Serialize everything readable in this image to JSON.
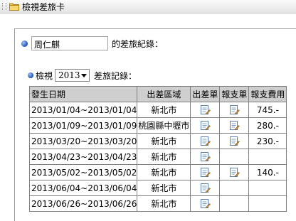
{
  "window": {
    "title": "檢視差旅卡"
  },
  "form": {
    "employee_name": "周仁麒",
    "name_suffix": "的差旅紀錄：",
    "year_label": "檢視",
    "year_value": "2013",
    "year_suffix": "差旅記錄："
  },
  "table": {
    "headers": [
      "發生日期",
      "出差區域",
      "出差單",
      "報支單",
      "報支費用"
    ],
    "rows": [
      {
        "date": "2013/01/04~2013/01/04",
        "area": "新北市",
        "has_trip": true,
        "has_report": true,
        "fee": "745.-"
      },
      {
        "date": "2013/01/09~2013/01/09",
        "area": "桃園縣中壢市",
        "has_trip": true,
        "has_report": true,
        "fee": "280.-"
      },
      {
        "date": "2013/03/20~2013/03/20",
        "area": "新北市",
        "has_trip": true,
        "has_report": true,
        "fee": "230.-"
      },
      {
        "date": "2013/04/23~2013/04/23",
        "area": "新北市",
        "has_trip": true,
        "has_report": false,
        "fee": ""
      },
      {
        "date": "2013/05/02~2013/05/02",
        "area": "新北市",
        "has_trip": true,
        "has_report": true,
        "fee": "140.-"
      },
      {
        "date": "2013/06/04~2013/06/04",
        "area": "新北市",
        "has_trip": true,
        "has_report": false,
        "fee": ""
      },
      {
        "date": "2013/06/26~2013/06/26",
        "area": "新北市",
        "has_trip": true,
        "has_report": false,
        "fee": ""
      }
    ]
  },
  "icons": {
    "titlebar": "folder-icon",
    "trip_doc": "trip-document-icon",
    "report_doc": "report-document-icon"
  },
  "colors": {
    "header_bg": "#cfcfcf",
    "bullet": "#1c4fb3"
  }
}
